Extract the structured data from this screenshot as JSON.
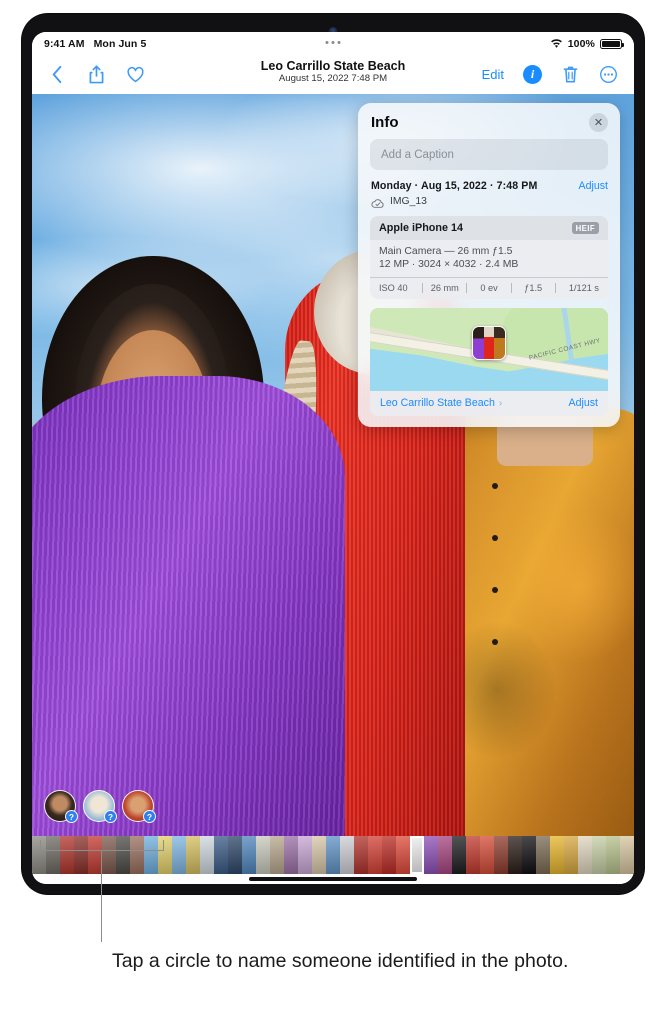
{
  "status_bar": {
    "time": "9:41 AM",
    "date": "Mon Jun 5",
    "battery_percent": "100%",
    "wifi_icon": "wifi-icon",
    "battery_icon": "battery-icon",
    "dots_icon": "multitasking-dots-icon"
  },
  "toolbar": {
    "back_icon": "chevron-left-icon",
    "share_icon": "share-icon",
    "favorite_icon": "heart-icon",
    "title": "Leo Carrillo State Beach",
    "subtitle": "August 15, 2022  7:48 PM",
    "edit_label": "Edit",
    "info_label": "i",
    "info_icon": "info-circle-icon",
    "delete_icon": "trash-icon",
    "more_icon": "ellipsis-circle-icon"
  },
  "info_panel": {
    "title": "Info",
    "close_icon": "close-icon",
    "caption_placeholder": "Add a Caption",
    "date_line": "Monday · Aug 15, 2022 · 7:48 PM",
    "date_adjust_label": "Adjust",
    "cloud_icon": "icloud-check-icon",
    "file_name": "IMG_13",
    "device": {
      "name": "Apple iPhone 14",
      "format_badge": "HEIF",
      "lens_line": "Main Camera — 26 mm ƒ1.5",
      "size_line": "12 MP · 3024 × 4032 · 2.4 MB",
      "stats": [
        "ISO 40",
        "26 mm",
        "0 ev",
        "ƒ1.5",
        "1/121 s"
      ]
    },
    "map": {
      "road_label": "PACIFIC COAST HWY",
      "place_name": "Leo Carrillo State Beach",
      "chevron_icon": "chevron-right-icon",
      "adjust_label": "Adjust",
      "pin_icon": "photo-pin-icon"
    }
  },
  "face_chips": [
    {
      "name": "face-chip-1",
      "badge": "?"
    },
    {
      "name": "face-chip-2",
      "badge": "?"
    },
    {
      "name": "face-chip-3",
      "badge": "?"
    }
  ],
  "filmstrip": {
    "thumb_colors": [
      "#8d8a83",
      "#6e6a63",
      "#b2352c",
      "#8b2f28",
      "#c1392f",
      "#7c5a4e",
      "#4d4a45",
      "#9a6f5d",
      "#6fb0e0",
      "#e3d26a",
      "#7fb6e2",
      "#d6c060",
      "#cfd8e0",
      "#3a5a86",
      "#2d4668",
      "#4f86bd",
      "#c9cbbd",
      "#b8a88e",
      "#9b6fa6",
      "#c9a7d4",
      "#d9c7a8",
      "#5f93c7",
      "#cfcfd6",
      "#b03229",
      "#d44034",
      "#bb2a22",
      "#e04a3a",
      "#f0f0f2",
      "#8e4fb8",
      "#a7447f",
      "#1c1c1e",
      "#c2392c",
      "#d64b38",
      "#8e3a2c",
      "#2a1c16",
      "#0e0e10",
      "#7a6a52",
      "#e8b52a",
      "#d9a83f",
      "#e2d7c0",
      "#c7d0a6",
      "#b7c28c",
      "#d8c6a0",
      "#9fae74",
      "#c8976f",
      "#a8693f",
      "#7e8f56",
      "#d7b98e",
      "#c4c9a3",
      "#e0cfae",
      "#cf8f6f",
      "#b86a4a",
      "#e7d9c2",
      "#a9b882",
      "#c3cfa9",
      "#8ea869",
      "#dcd0b4",
      "#b5c592",
      "#d7bfa0",
      "#ecdcc4",
      "#c79b78",
      "#9d7f5e",
      "#8ea35f",
      "#b7c585"
    ]
  },
  "callout": {
    "text": "Tap a circle to name someone identified in the photo."
  },
  "colors": {
    "accent": "#1a8cff",
    "panel_bg": "#f6f8fa",
    "badge_blue": "#2f80ed"
  }
}
